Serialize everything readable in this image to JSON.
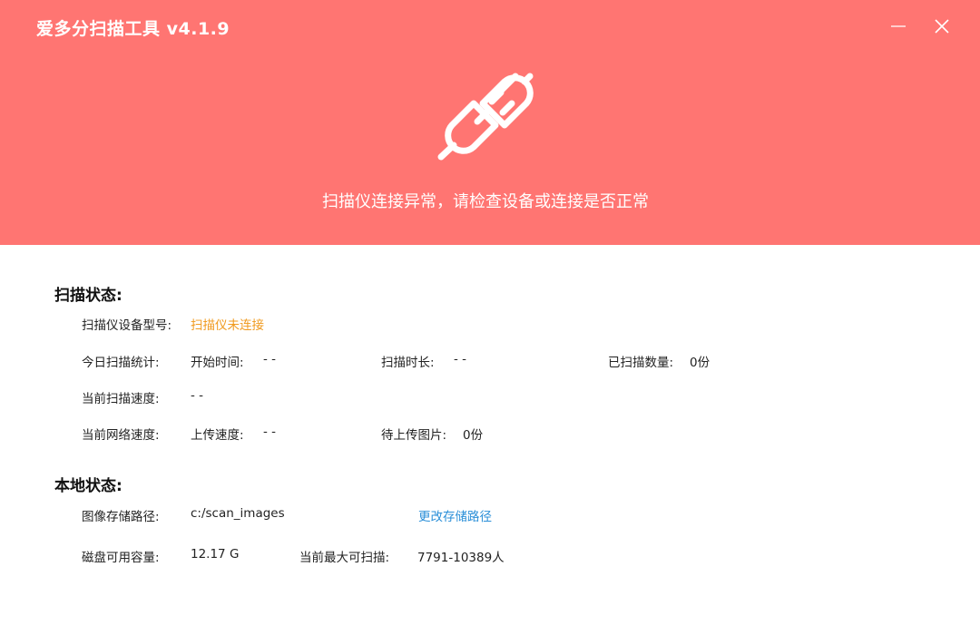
{
  "window": {
    "title": "爱多分扫描工具 v4.1.9",
    "controls": {
      "minimize": "minimize-icon",
      "close": "close-icon"
    }
  },
  "banner": {
    "icon": "unplugged-icon",
    "message": "扫描仪连接异常，请检查设备或连接是否正常"
  },
  "scan_status": {
    "title": "扫描状态:",
    "device_model": {
      "label": "扫描仪设备型号:",
      "value": "扫描仪未连接"
    },
    "today_stats": {
      "label": "今日扫描统计:",
      "start_time_label": "开始时间:",
      "start_time": "- -",
      "duration_label": "扫描时长:",
      "duration": "- -",
      "count_label": "已扫描数量:",
      "count": "0份"
    },
    "scan_speed": {
      "label": "当前扫描速度:",
      "value": "- -"
    },
    "network": {
      "label": "当前网络速度:",
      "upload_label": "上传速度:",
      "upload": "- -",
      "pending_label": "待上传图片:",
      "pending": "0份"
    }
  },
  "local_status": {
    "title": "本地状态:",
    "storage_path": {
      "label": "图像存储路径:",
      "value": "c:/scan_images",
      "change_link": "更改存储路径"
    },
    "disk": {
      "label": "磁盘可用容量:",
      "value": "12.17 G",
      "max_label": "当前最大可扫描:",
      "max_value": "7791-10389人"
    }
  },
  "colors": {
    "header": "#ff7572",
    "warning": "#f09a1e",
    "link": "#2b8fd8"
  }
}
